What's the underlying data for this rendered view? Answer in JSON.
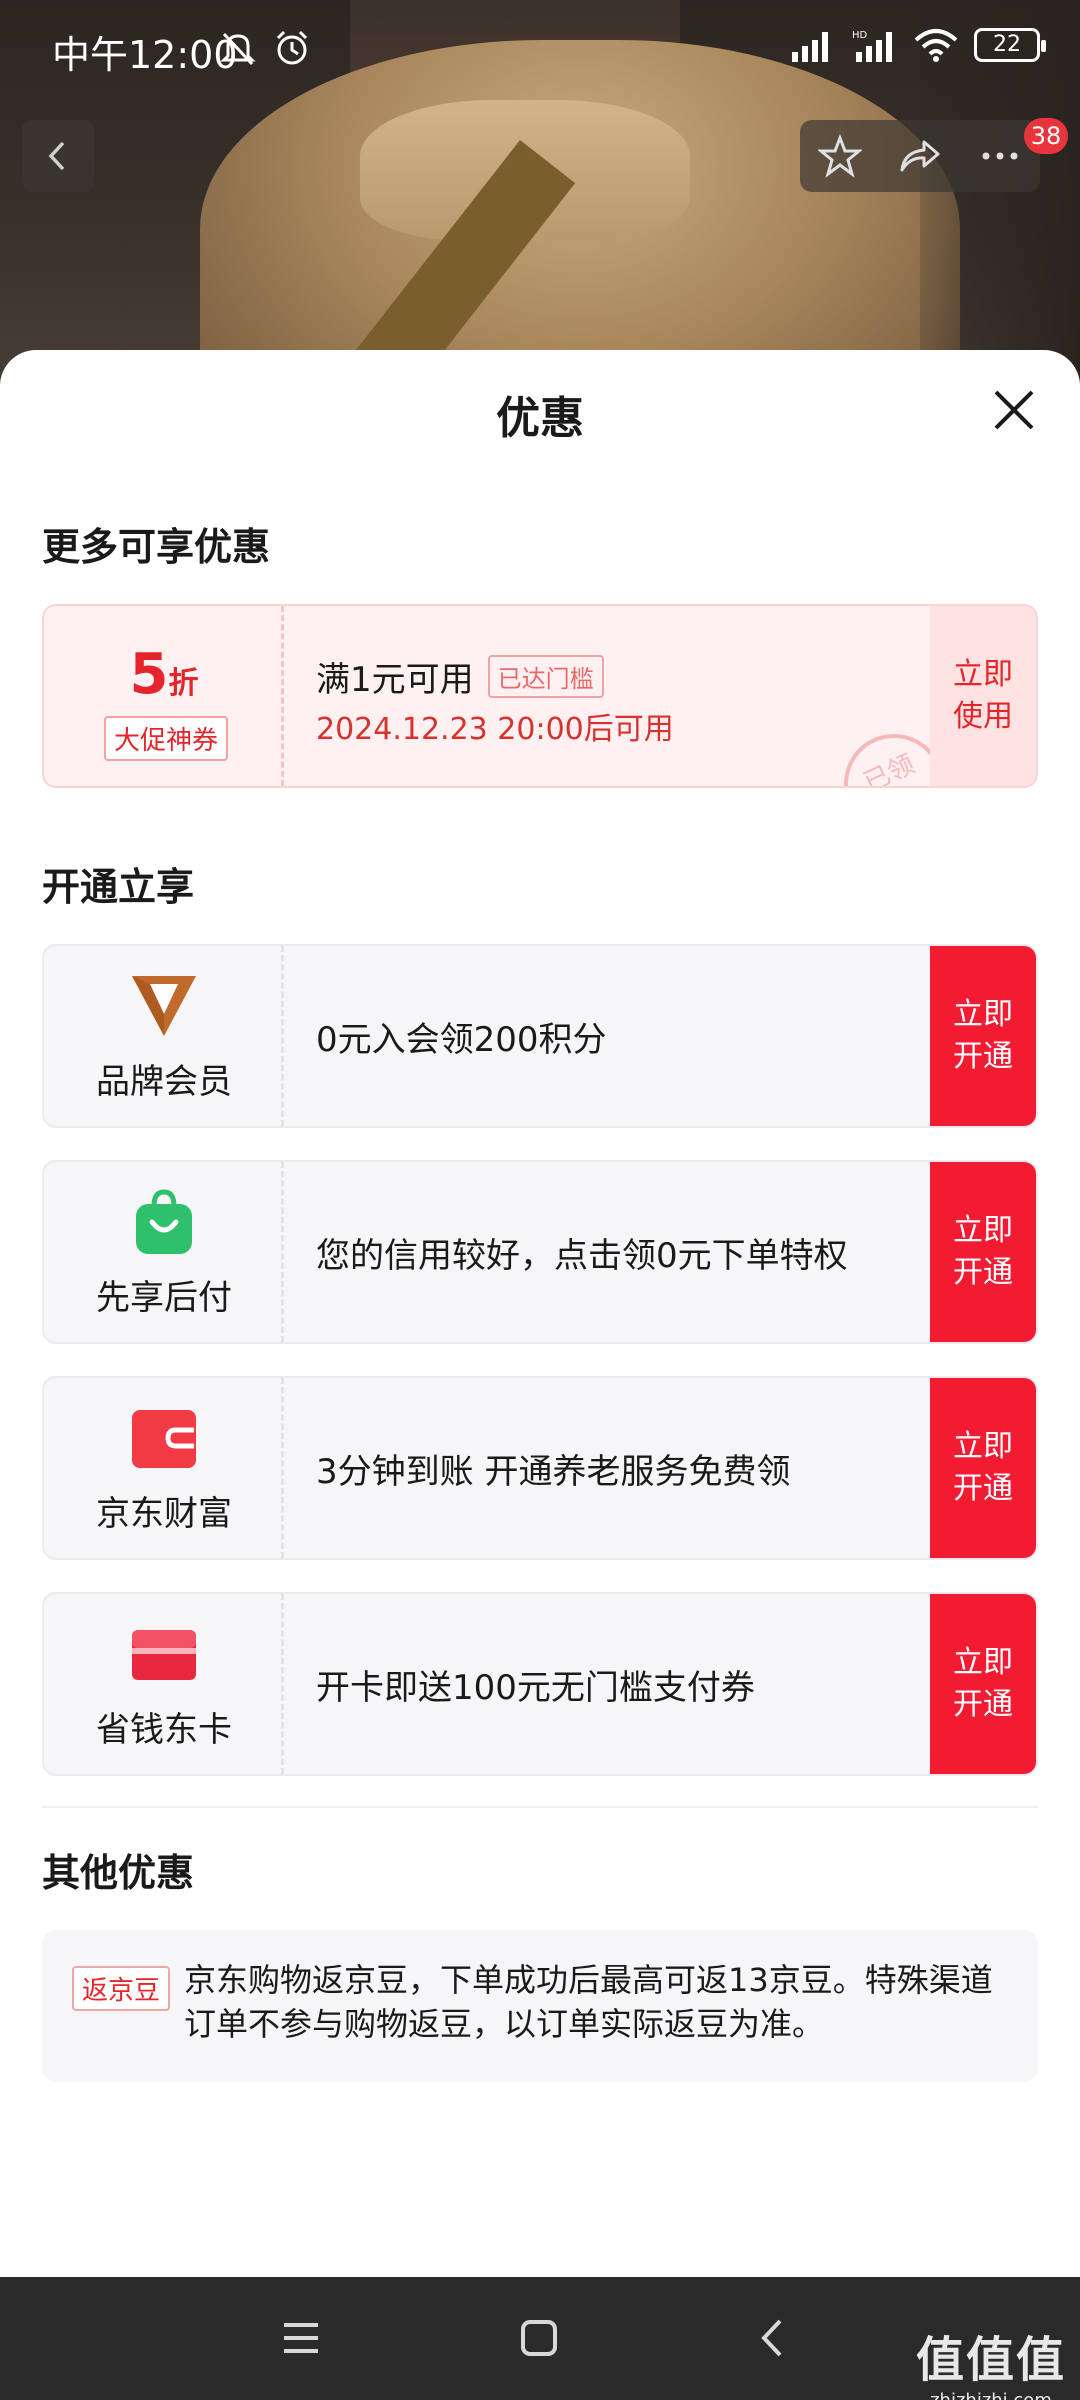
{
  "status_bar": {
    "time": "中午12:00",
    "battery": "22"
  },
  "header": {
    "notification_count": "38"
  },
  "sheet": {
    "title": "优惠",
    "more_section": {
      "title": "更多可享优惠",
      "coupon": {
        "amount": "5",
        "unit": "折",
        "tag": "大促神券",
        "condition": "满1元可用",
        "reached_label": "已达门槛",
        "date": "2024.12.23 20:00后可用",
        "action": "立即\n使用",
        "stamp": "已领"
      }
    },
    "open_section": {
      "title": "开通立享",
      "cards": [
        {
          "label": "品牌会员",
          "icon": "brand-member-v-icon",
          "desc": "0元入会领200积分",
          "action": "立即\n开通",
          "color": "#c26a2c"
        },
        {
          "label": "先享后付",
          "icon": "shopping-bag-icon",
          "desc": "您的信用较好，点击领0元下单特权",
          "action": "立即\n开通",
          "color": "#2fc06b"
        },
        {
          "label": "京东财富",
          "icon": "wallet-icon",
          "desc": "3分钟到账 开通养老服务免费领",
          "action": "立即\n开通",
          "color": "#f03a44"
        },
        {
          "label": "省钱东卡",
          "icon": "bank-card-icon",
          "desc": "开卡即送100元无门槛支付券",
          "action": "立即\n开通",
          "color": "#e8283f"
        }
      ]
    },
    "other_section": {
      "title": "其他优惠",
      "tag": "返京豆",
      "text": "京东购物返京豆，下单成功后最高可返13京豆。特殊渠道订单不参与购物返豆，以订单实际返豆为准。"
    }
  },
  "watermark": {
    "main": "值值值",
    "sub": "zhizhizhi.com"
  },
  "colors": {
    "accent_red": "#f21b31",
    "coupon_bg": "#fff1f1"
  }
}
